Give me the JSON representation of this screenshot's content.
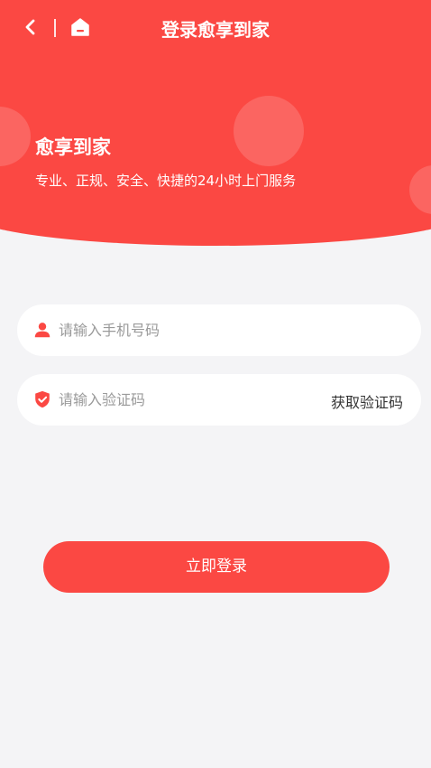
{
  "header": {
    "title": "登录愈享到家",
    "back_icon": "chevron-left-icon",
    "home_icon": "home-icon"
  },
  "hero": {
    "brand_title": "愈享到家",
    "brand_subtitle": "专业、正规、安全、快捷的24小时上门服务"
  },
  "form": {
    "phone": {
      "placeholder": "请输入手机号码",
      "value": "",
      "icon": "user-icon"
    },
    "code": {
      "placeholder": "请输入验证码",
      "value": "",
      "icon": "shield-check-icon"
    },
    "get_code_label": "获取验证码",
    "submit_label": "立即登录"
  },
  "colors": {
    "accent": "#fb4843",
    "background": "#f4f4f6",
    "field_bg": "#ffffff",
    "placeholder": "#9a9a9a"
  }
}
